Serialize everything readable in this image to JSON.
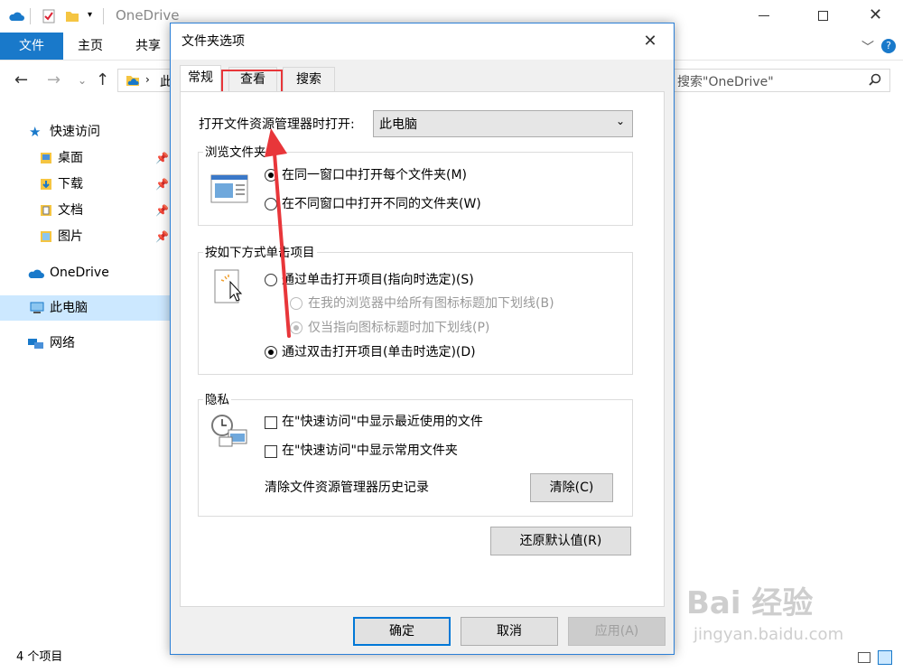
{
  "explorer": {
    "title": "OneDrive",
    "ribbon_tabs": [
      "文件",
      "主页",
      "共享"
    ],
    "address_fragment": "此",
    "search_placeholder": "搜索\"OneDrive\"",
    "sidebar": {
      "quick_access": "快速访问",
      "pinned": [
        "桌面",
        "下载",
        "文档",
        "图片"
      ],
      "onedrive": "OneDrive",
      "this_pc": "此电脑",
      "network": "网络"
    },
    "status": "4 个项目"
  },
  "dialog": {
    "title": "文件夹选项",
    "tabs": [
      "常规",
      "查看",
      "搜索"
    ],
    "open_in_label": "打开文件资源管理器时打开:",
    "open_in_value": "此电脑",
    "browse_group": {
      "title": "浏览文件夹",
      "options": [
        "在同一窗口中打开每个文件夹(M)",
        "在不同窗口中打开不同的文件夹(W)"
      ]
    },
    "click_group": {
      "title": "按如下方式单击项目",
      "single": "通过单击打开项目(指向时选定)(S)",
      "underline_all": "在我的浏览器中给所有图标标题加下划线(B)",
      "underline_hover": "仅当指向图标标题时加下划线(P)",
      "double": "通过双击打开项目(单击时选定)(D)"
    },
    "privacy_group": {
      "title": "隐私",
      "recent_files": "在\"快速访问\"中显示最近使用的文件",
      "frequent_folders": "在\"快速访问\"中显示常用文件夹",
      "clear_label": "清除文件资源管理器历史记录",
      "clear_button": "清除(C)"
    },
    "restore_button": "还原默认值(R)",
    "ok_button": "确定",
    "cancel_button": "取消",
    "apply_button": "应用(A)"
  },
  "watermark": {
    "brand": "Bai 经验",
    "url": "jingyan.baidu.com"
  },
  "colors": {
    "accent": "#1979ca",
    "highlight_box": "#e8363a",
    "selected_item": "#cce8ff"
  }
}
